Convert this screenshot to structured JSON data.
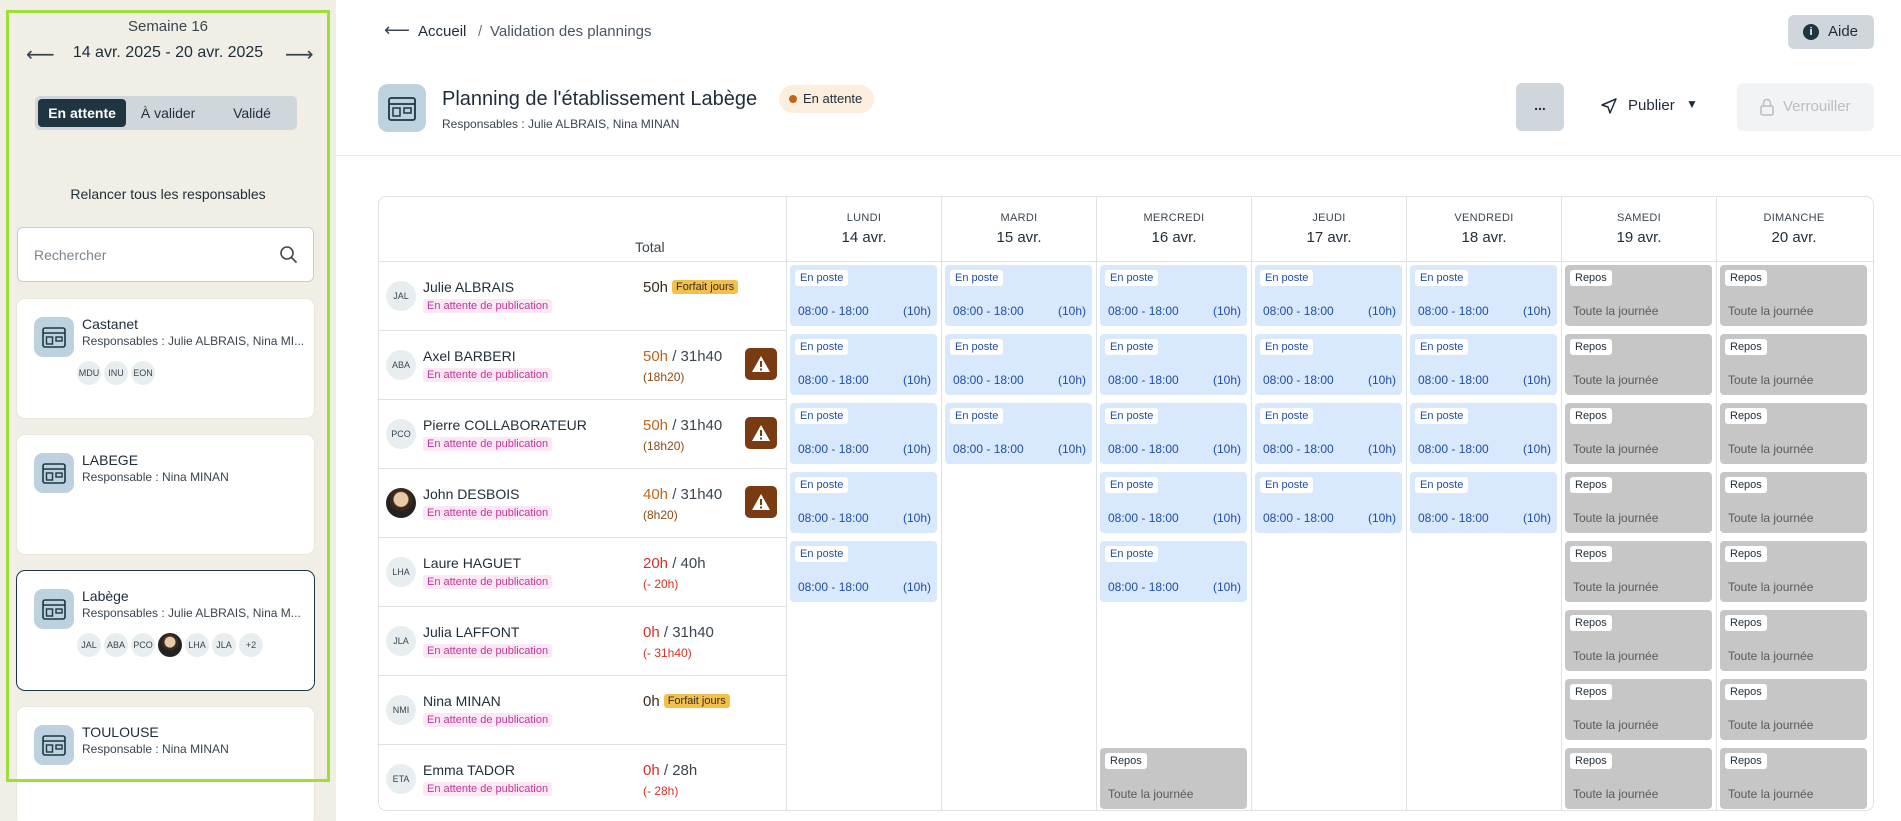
{
  "sidebar": {
    "week_label": "Semaine 16",
    "week_range": "14 avr. 2025 - 20 avr. 2025",
    "prev_arrow": "⟵",
    "next_arrow": "⟶",
    "tabs": [
      "En attente",
      "À valider",
      "Validé"
    ],
    "relaunch": "Relancer tous les responsables",
    "search_placeholder": "Rechercher",
    "establishments": [
      {
        "name": "Castanet",
        "resp": "Responsables : Julie ALBRAIS, Nina MI...",
        "chips": [
          "MDU",
          "INU",
          "EON"
        ]
      },
      {
        "name": "LABEGE",
        "resp": "Responsable : Nina MINAN",
        "chips": []
      },
      {
        "name": "Labège",
        "resp": "Responsables : Julie ALBRAIS, Nina M...",
        "chips": [
          "JAL",
          "ABA",
          "PCO",
          "",
          "LHA",
          "JLA",
          "+2"
        ]
      },
      {
        "name": "TOULOUSE",
        "resp": "Responsable : Nina MINAN",
        "chips": []
      }
    ]
  },
  "header": {
    "back": "⟵",
    "breadcrumb_home": "Accueil",
    "breadcrumb_sep": "/",
    "breadcrumb_current": "Validation des plannings",
    "help": "Aide",
    "title": "Planning de l'établissement Labège",
    "status": "En attente",
    "responsables": "Responsables : Julie ALBRAIS, Nina MINAN",
    "more": "...",
    "publish": "Publier",
    "lock": "Verrouiller"
  },
  "grid": {
    "total_label": "Total",
    "days": [
      {
        "name": "LUNDI",
        "date": "14 avr."
      },
      {
        "name": "MARDI",
        "date": "15 avr."
      },
      {
        "name": "MERCREDI",
        "date": "16 avr."
      },
      {
        "name": "JEUDI",
        "date": "17 avr."
      },
      {
        "name": "VENDREDI",
        "date": "18 avr."
      },
      {
        "name": "SAMEDI",
        "date": "19 avr."
      },
      {
        "name": "DIMANCHE",
        "date": "20 avr."
      }
    ],
    "shift_label": "En poste",
    "shift_time": "08:00 - 18:00",
    "shift_dur": "(10h)",
    "repos_label": "Repos",
    "repos_time": "Toute la journée",
    "employees": [
      {
        "initials": "JAL",
        "name": "Julie ALBRAIS",
        "status": "En attente de publication",
        "hours": "50h",
        "ref": "",
        "diff": "",
        "forfait": "Forfait jours",
        "warn": false,
        "color": "dark",
        "days": [
          "P",
          "P",
          "P",
          "P",
          "P",
          "R",
          "R"
        ]
      },
      {
        "initials": "ABA",
        "name": "Axel BARBERI",
        "status": "En attente de publication",
        "hours": "50h",
        "ref": " / 31h40",
        "diff": "(18h20)",
        "forfait": "",
        "warn": true,
        "color": "orange",
        "days": [
          "P",
          "P",
          "P",
          "P",
          "P",
          "R",
          "R"
        ]
      },
      {
        "initials": "PCO",
        "name": "Pierre COLLABORATEUR",
        "status": "En attente de publication",
        "hours": "50h",
        "ref": " / 31h40",
        "diff": "(18h20)",
        "forfait": "",
        "warn": true,
        "color": "orange",
        "days": [
          "P",
          "P",
          "P",
          "P",
          "P",
          "R",
          "R"
        ]
      },
      {
        "initials": "",
        "name": "John DESBOIS",
        "status": "En attente de publication",
        "hours": "40h",
        "ref": " / 31h40",
        "diff": "(8h20)",
        "forfait": "",
        "warn": true,
        "color": "orange",
        "days": [
          "P",
          "",
          "P",
          "P",
          "P",
          "R",
          "R"
        ]
      },
      {
        "initials": "LHA",
        "name": "Laure HAGUET",
        "status": "En attente de publication",
        "hours": "20h",
        "ref": " / 40h",
        "diff": "(- 20h)",
        "forfait": "",
        "warn": false,
        "color": "red",
        "days": [
          "P",
          "",
          "P",
          "",
          "",
          "R",
          "R"
        ]
      },
      {
        "initials": "JLA",
        "name": "Julia LAFFONT",
        "status": "En attente de publication",
        "hours": "0h",
        "ref": " / 31h40",
        "diff": "(- 31h40)",
        "forfait": "",
        "warn": false,
        "color": "red",
        "days": [
          "",
          "",
          "",
          "",
          "",
          "R",
          "R"
        ]
      },
      {
        "initials": "NMI",
        "name": "Nina MINAN",
        "status": "En attente de publication",
        "hours": "0h",
        "ref": "",
        "diff": "",
        "forfait": "Forfait jours",
        "warn": false,
        "color": "dark",
        "days": [
          "",
          "",
          "",
          "",
          "",
          "R",
          "R"
        ]
      },
      {
        "initials": "ETA",
        "name": "Emma TADOR",
        "status": "En attente de publication",
        "hours": "0h",
        "ref": " / 28h",
        "diff": "(- 28h)",
        "forfait": "",
        "warn": false,
        "color": "red",
        "days": [
          "",
          "",
          "R",
          "",
          "",
          "R",
          "R"
        ]
      }
    ]
  }
}
